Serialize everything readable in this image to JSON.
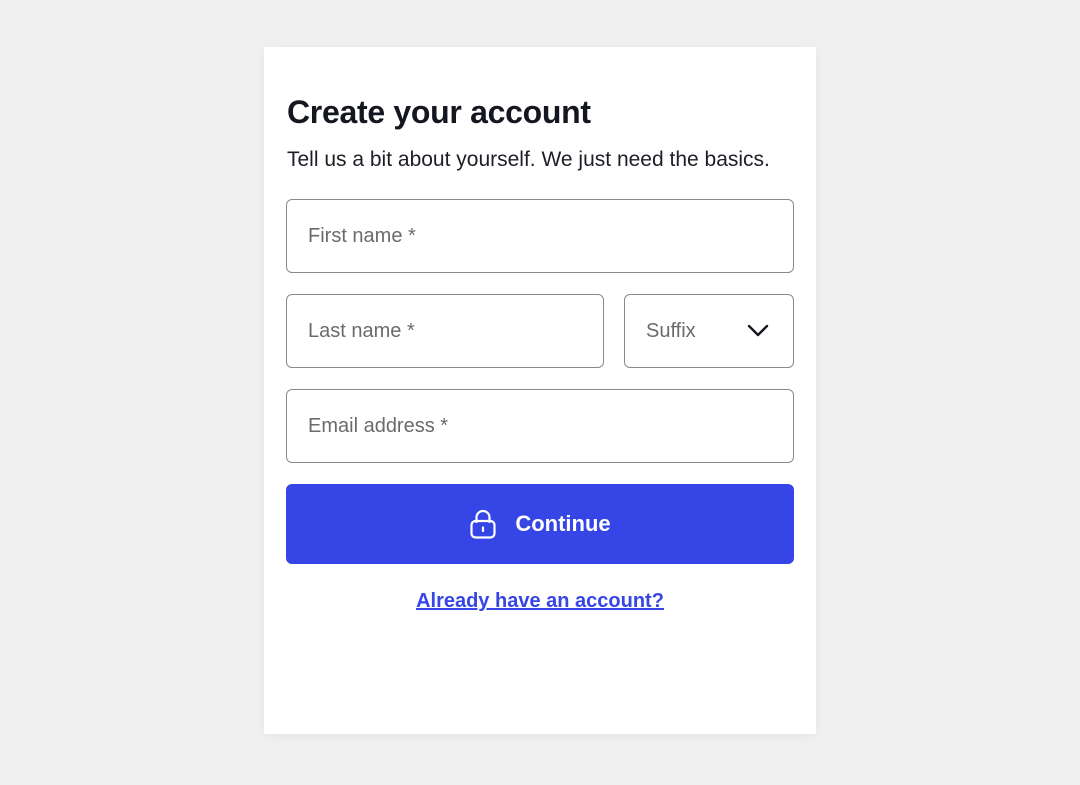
{
  "form": {
    "title": "Create your account",
    "subtitle": "Tell us a bit about yourself. We just need the basics.",
    "first_name": {
      "value": "",
      "placeholder": "First name *"
    },
    "last_name": {
      "value": "",
      "placeholder": "Last name *"
    },
    "suffix": {
      "selected": "Suffix",
      "icon": "chevron-down-icon"
    },
    "email": {
      "value": "",
      "placeholder": "Email address *"
    },
    "continue_button": {
      "label": "Continue",
      "icon": "lock-icon"
    },
    "signin_link": "Already have an account?"
  },
  "colors": {
    "page_background": "#f0f0f0",
    "card_background": "#ffffff",
    "accent": "#3545e6",
    "title_text": "#14171f",
    "field_border": "#8a8a8a",
    "placeholder_text": "#6b6b6b"
  }
}
